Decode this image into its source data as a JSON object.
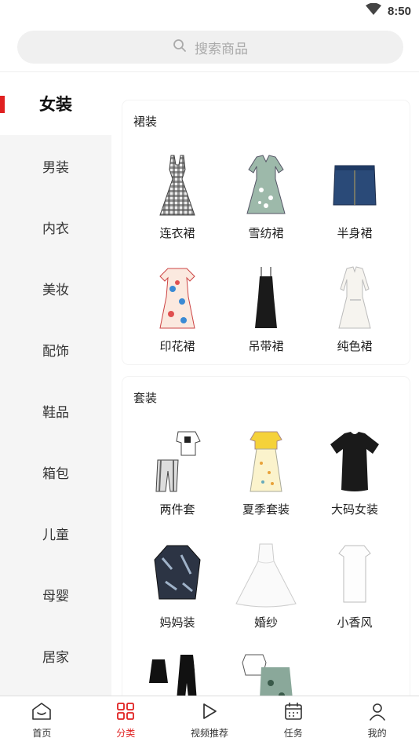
{
  "status_bar": {
    "time": "8:50"
  },
  "search": {
    "placeholder": "搜索商品"
  },
  "sidebar": {
    "items": [
      {
        "label": "女装"
      },
      {
        "label": "男装"
      },
      {
        "label": "内衣"
      },
      {
        "label": "美妆"
      },
      {
        "label": "配饰"
      },
      {
        "label": "鞋品"
      },
      {
        "label": "箱包"
      },
      {
        "label": "儿童"
      },
      {
        "label": "母婴"
      },
      {
        "label": "居家"
      }
    ]
  },
  "sections": [
    {
      "title": "裙装",
      "items": [
        {
          "label": "连衣裙"
        },
        {
          "label": "雪纺裙"
        },
        {
          "label": "半身裙"
        },
        {
          "label": "印花裙"
        },
        {
          "label": "吊带裙"
        },
        {
          "label": "纯色裙"
        }
      ]
    },
    {
      "title": "套装",
      "items": [
        {
          "label": "两件套"
        },
        {
          "label": "夏季套装"
        },
        {
          "label": "大码女装"
        },
        {
          "label": "妈妈装"
        },
        {
          "label": "婚纱"
        },
        {
          "label": "小香风"
        }
      ]
    }
  ],
  "bottom_nav": {
    "items": [
      {
        "label": "首页",
        "icon": "home-icon"
      },
      {
        "label": "分类",
        "icon": "category-icon"
      },
      {
        "label": "视频推荐",
        "icon": "play-icon"
      },
      {
        "label": "任务",
        "icon": "calendar-icon"
      },
      {
        "label": "我的",
        "icon": "user-icon"
      }
    ]
  },
  "colors": {
    "accent": "#e02020"
  }
}
